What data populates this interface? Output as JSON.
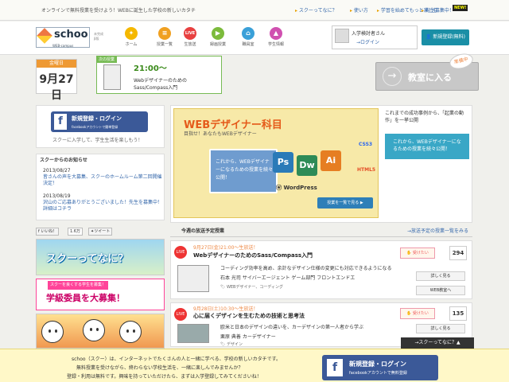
{
  "topbar": {
    "lead": "オンラインで無料授業を受けよう！WEBに誕生した学校の新しいカタチ",
    "links": [
      "スクーってなに？",
      "使い方",
      "学習を始めてもっと楽しむ",
      "先生募集中！"
    ],
    "new_badge": "NEW!"
  },
  "header": {
    "logo_name": "schoo",
    "logo_sub": "WEB-campus",
    "beta": "未完成β版",
    "nav": [
      {
        "label": "ホーム",
        "icon": "lightbulb-icon",
        "color": "#f5b800",
        "glyph": "✦"
      },
      {
        "label": "授業一覧",
        "icon": "list-icon",
        "color": "#f0a020",
        "glyph": "≡"
      },
      {
        "label": "生放送",
        "icon": "live-icon",
        "color": "#e84040",
        "glyph": "LIVE"
      },
      {
        "label": "録画授業",
        "icon": "video-icon",
        "color": "#7cbb3c",
        "glyph": "▶"
      },
      {
        "label": "職員室",
        "icon": "building-icon",
        "color": "#3aa0d8",
        "glyph": "⌂"
      },
      {
        "label": "学生情報",
        "icon": "graduation-icon",
        "color": "#d050b0",
        "glyph": "▲"
      }
    ],
    "user_name": "入学検討者さん",
    "login": "→ログイン",
    "signup": "新規登録(無料)"
  },
  "date": {
    "header": "金曜日",
    "value": "9月27日"
  },
  "next_class": {
    "tag": "次の授業",
    "time": "21:00〜",
    "title": "WebデザイナーのためのSass/Compass入門"
  },
  "enter": {
    "label": "教室に入る",
    "ribbon": "準備中"
  },
  "facebook": {
    "line1": "新規登録・ログイン",
    "line2": "facebookアカウントで簡単登録",
    "caption": "スクーに入学して、学生生活を楽しもう！"
  },
  "notice": {
    "title": "スクーからのお知らせ",
    "items": [
      {
        "date": "2013/08/27",
        "message": "皆さんの声を大募集、スクーのホームルーム第二回開催決定！"
      },
      {
        "date": "2013/08/19",
        "message": "沢山のご応募ありがとうございました！先生を募集中！詳細はコチラ"
      }
    ]
  },
  "share": {
    "like": "いいね！",
    "like_count": "1.6万",
    "tweet": "ツイート"
  },
  "banners": {
    "b1": "スクーってなに？",
    "b2_small": "スクーを良くする学生を募集！",
    "b2": "学級委員を大募集！"
  },
  "feature": {
    "title": "WEBデザイナー科目",
    "subtitle": "目指せ！あなたもWEBデザイナー",
    "screen_text": "これから、WEBデザイナーになるための授業を続々公開！",
    "apps": [
      {
        "label": "Ps",
        "color": "#2a7ab8"
      },
      {
        "label": "Dw",
        "color": "#2e8b57"
      },
      {
        "label": "Ai",
        "color": "#e67e22"
      }
    ],
    "tech": [
      "CSS3",
      "HTML5"
    ],
    "wordpress": "WordPress",
    "button": "授業を一覧で見る ▶",
    "side_text": "これまでの成功事例から、「起業の動作」を一挙公開",
    "side_box": "これから、WEBデザイナーになるための授業を続々公開！"
  },
  "schedule": {
    "title": "今週の放送予定授業",
    "more": "→放送予定の授業一覧をみる",
    "rows": [
      {
        "time": "9月27日(金)21:00〜生放送！",
        "title": "WebデザイナーのためのSass/Compass入門",
        "desc": "コーディング効率を高め、余計なデザイン仕様の変更にも対応できるようになる",
        "teacher": "石本 光司  サイバーエージェント  ゲーム部門  フロントエンドエ",
        "tags": "WEBデザイナー、コーディング",
        "fav": "受けたい",
        "count": "294",
        "detail": "詳しく見る",
        "reserve": "WEB教室へ"
      },
      {
        "time": "9月28日(土)10:30〜生放送！",
        "title": "心に届くデザインを生むための技術と思考法",
        "desc": "欧米と日本のデザインの違いを、カーデザインの第一人者から学ぶ",
        "teacher": "栗原 典善  カーデザイナー",
        "tags": "デザイン",
        "fav": "受けたい",
        "count": "135",
        "detail": "詳しく見る"
      }
    ]
  },
  "scroll_top": "→スクーってなに？▲",
  "footer": {
    "line1": "schoo（スクー）は、インターネットでたくさんの人と一緒に学べる、学校の新しいカタチです。",
    "line2": "無料授業を受けながら、終わらない学校生活を、一緒に楽しんでみませんか？",
    "line3": "登録・利用は無料です。興味を持っていただけたら、まずは入学登録してみてくださいね！",
    "btn1": "新規登録・ログイン",
    "btn2": "facebookアカウントで無料登録"
  }
}
